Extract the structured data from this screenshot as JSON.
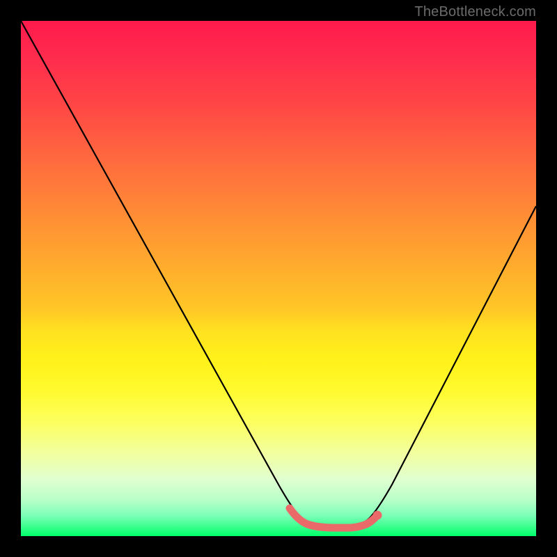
{
  "watermark": "TheBottleneck.com",
  "colors": {
    "frame": "#000000",
    "curve": "#000000",
    "marker": "#ea6a6a",
    "gradient_top": "#ff1a4d",
    "gradient_bottom": "#00ff6a"
  },
  "chart_data": {
    "type": "line",
    "title": "",
    "xlabel": "",
    "ylabel": "",
    "xlim": [
      0,
      100
    ],
    "ylim": [
      0,
      100
    ],
    "x": [
      0,
      5,
      10,
      15,
      20,
      25,
      30,
      35,
      40,
      45,
      50,
      52,
      55,
      58,
      60,
      62,
      64,
      66,
      70,
      75,
      80,
      85,
      90,
      95,
      100
    ],
    "values": [
      100,
      91,
      82,
      73,
      64,
      55,
      46,
      37,
      28,
      19,
      10,
      6,
      3,
      2,
      2,
      2,
      3,
      6,
      12,
      20,
      28,
      37,
      46,
      55,
      64
    ],
    "curve_points": [
      {
        "x": 0,
        "y": 100
      },
      {
        "x": 50,
        "y": 10
      },
      {
        "x": 55,
        "y": 3
      },
      {
        "x": 58,
        "y": 2
      },
      {
        "x": 64,
        "y": 2
      },
      {
        "x": 67,
        "y": 3
      },
      {
        "x": 72,
        "y": 10
      },
      {
        "x": 100,
        "y": 64
      }
    ],
    "marker_band": {
      "x_start": 52,
      "x_end": 67,
      "y": 2
    },
    "marker_dot": {
      "x": 67,
      "y": 3
    }
  }
}
